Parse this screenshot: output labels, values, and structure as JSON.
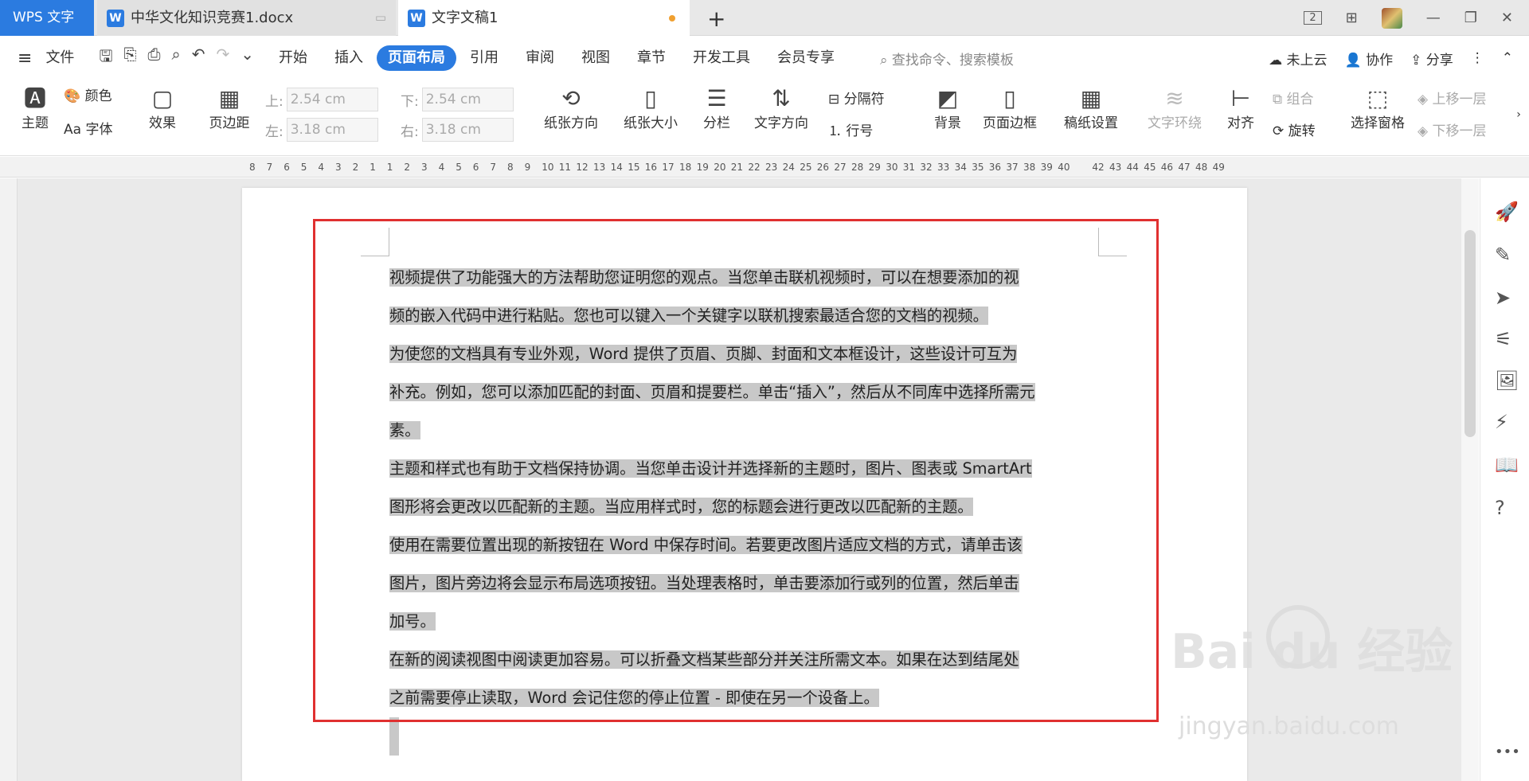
{
  "titlebar": {
    "app_tab": "WPS 文字",
    "tabs": [
      {
        "label": "中华文化知识竞赛1.docx",
        "icon": "W"
      },
      {
        "label": "文字文稿1",
        "icon": "W"
      }
    ],
    "new_tab": "+",
    "page_badge": "2"
  },
  "menu": {
    "file": "文件",
    "items": [
      "开始",
      "插入",
      "页面布局",
      "引用",
      "审阅",
      "视图",
      "章节",
      "开发工具",
      "会员专享"
    ],
    "active": "页面布局",
    "search_placeholder": "查找命令、搜索模板",
    "cloud": "未上云",
    "collab": "协作",
    "share": "分享"
  },
  "ribbon": {
    "theme": "主题",
    "color": "颜色",
    "font": "字体",
    "effect": "效果",
    "margins": "页边距",
    "margin_top_label": "上:",
    "margin_top": "2.54 cm",
    "margin_bottom_label": "下:",
    "margin_bottom": "2.54 cm",
    "margin_left_label": "左:",
    "margin_left": "3.18 cm",
    "margin_right_label": "右:",
    "margin_right": "3.18 cm",
    "orientation": "纸张方向",
    "size": "纸张大小",
    "columns": "分栏",
    "text_direction": "文字方向",
    "separator": "分隔符",
    "line_number": "行号",
    "background": "背景",
    "page_border": "页面边框",
    "grid_paper": "稿纸设置",
    "wrap": "文字环绕",
    "align": "对齐",
    "group": "组合",
    "rotate": "旋转",
    "selection_pane": "选择窗格",
    "bring_forward": "上移一层",
    "send_backward": "下移一层"
  },
  "ruler": {
    "labels": [
      "8",
      "7",
      "6",
      "5",
      "4",
      "3",
      "2",
      "1",
      "1",
      "2",
      "3",
      "4",
      "5",
      "6",
      "7",
      "8",
      "9",
      "10",
      "11",
      "12",
      "13",
      "14",
      "15",
      "16",
      "17",
      "18",
      "19",
      "20",
      "21",
      "22",
      "23",
      "24",
      "25",
      "26",
      "27",
      "28",
      "29",
      "30",
      "31",
      "32",
      "33",
      "34",
      "35",
      "36",
      "37",
      "38",
      "39",
      "40",
      "42",
      "43",
      "44",
      "45",
      "46",
      "47",
      "48",
      "49"
    ]
  },
  "document": {
    "paragraphs": [
      [
        "视频提供了功能强大的方法帮助您证明您的观点。当您单击联机视频时，可以在想要添加的视",
        "频的嵌入代码中进行粘贴。您也可以键入一个关键字以联机搜索最适合您的文档的视频。"
      ],
      [
        "为使您的文档具有专业外观，Word 提供了页眉、页脚、封面和文本框设计，这些设计可互为",
        "补充。例如，您可以添加匹配的封面、页眉和提要栏。单击“插入”，然后从不同库中选择所需元",
        "素。"
      ],
      [
        "主题和样式也有助于文档保持协调。当您单击设计并选择新的主题时，图片、图表或 SmartArt",
        "图形将会更改以匹配新的主题。当应用样式时，您的标题会进行更改以匹配新的主题。"
      ],
      [
        "使用在需要位置出现的新按钮在 Word 中保存时间。若要更改图片适应文档的方式，请单击该",
        "图片，图片旁边将会显示布局选项按钮。当处理表格时，单击要添加行或列的位置，然后单击",
        "加号。"
      ],
      [
        "在新的阅读视图中阅读更加容易。可以折叠文档某些部分并关注所需文本。如果在达到结尾处",
        "之前需要停止读取，Word 会记住您的停止位置 - 即使在另一个设备上。"
      ]
    ]
  },
  "watermark": {
    "brand": "Bai du 经验",
    "url": "jingyan.baidu.com"
  },
  "colors": {
    "accent": "#2b7be0",
    "highlight_box": "#e03030",
    "selection": "#c8c8c8"
  }
}
